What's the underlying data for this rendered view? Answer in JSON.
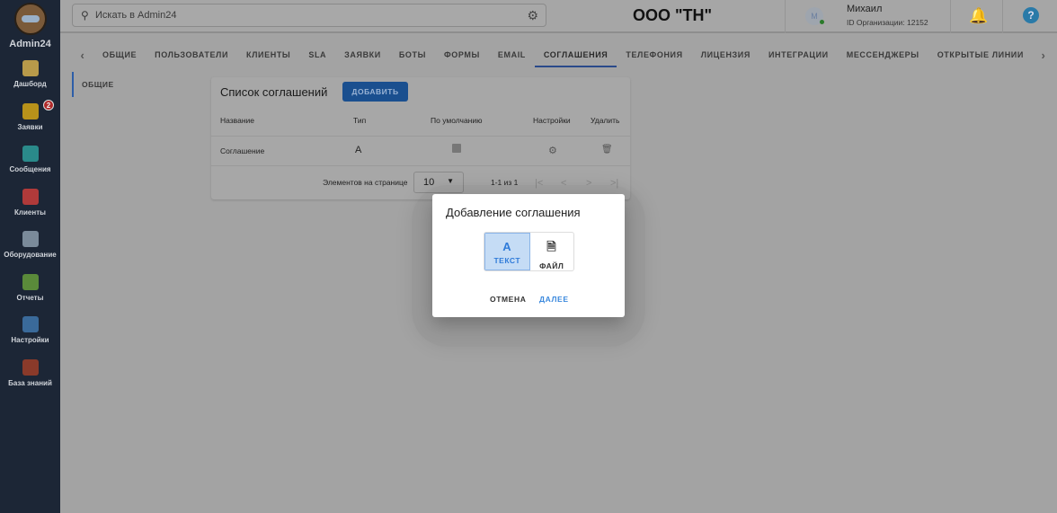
{
  "sidebar": {
    "brand": "Admin24",
    "items": [
      {
        "label": "Дашборд",
        "icon": "dashboard-icon",
        "color": "#b89a4a"
      },
      {
        "label": "Заявки",
        "icon": "megaphone-icon",
        "color": "#b8921a",
        "badge": "2"
      },
      {
        "label": "Сообщения",
        "icon": "chat-icon",
        "color": "#2a8a8a"
      },
      {
        "label": "Клиенты",
        "icon": "clients-icon",
        "color": "#b03a3a"
      },
      {
        "label": "Оборудование",
        "icon": "equipment-icon",
        "color": "#7a8a9a"
      },
      {
        "label": "Отчеты",
        "icon": "reports-icon",
        "color": "#5a8a3a"
      },
      {
        "label": "Настройки",
        "icon": "gear-icon",
        "color": "#3a6a9a"
      },
      {
        "label": "База знаний",
        "icon": "book-icon",
        "color": "#8a3a2a"
      }
    ]
  },
  "topbar": {
    "search_placeholder": "Искать в Admin24",
    "org": "ООО \"ТН\"",
    "avatar": "M",
    "user": "Михаил",
    "org_id": "ID Организации: 12152"
  },
  "tabs": [
    "ОБЩИЕ",
    "ПОЛЬЗОВАТЕЛИ",
    "КЛИЕНТЫ",
    "SLA",
    "ЗАЯВКИ",
    "БОТЫ",
    "ФОРМЫ",
    "EMAIL",
    "СОГЛАШЕНИЯ",
    "ТЕЛЕФОНИЯ",
    "ЛИЦЕНЗИЯ",
    "ИНТЕГРАЦИИ",
    "МЕССЕНДЖЕРЫ",
    "ОТКРЫТЫЕ ЛИНИИ"
  ],
  "active_tab": "СОГЛАШЕНИЯ",
  "subnav": "ОБЩИЕ",
  "card": {
    "title": "Список соглашений",
    "add": "ДОБАВИТЬ",
    "headers": [
      "Название",
      "Тип",
      "По умолчанию",
      "Настройки",
      "Удалить"
    ],
    "row": {
      "name": "Соглашение"
    },
    "per_page_label": "Элементов на странице",
    "per_page": "10",
    "range": "1-1 из 1"
  },
  "dialog": {
    "title": "Добавление соглашения",
    "text": "ТЕКСТ",
    "file": "ФАЙЛ",
    "cancel": "ОТМЕНА",
    "next": "ДАЛЕЕ"
  }
}
